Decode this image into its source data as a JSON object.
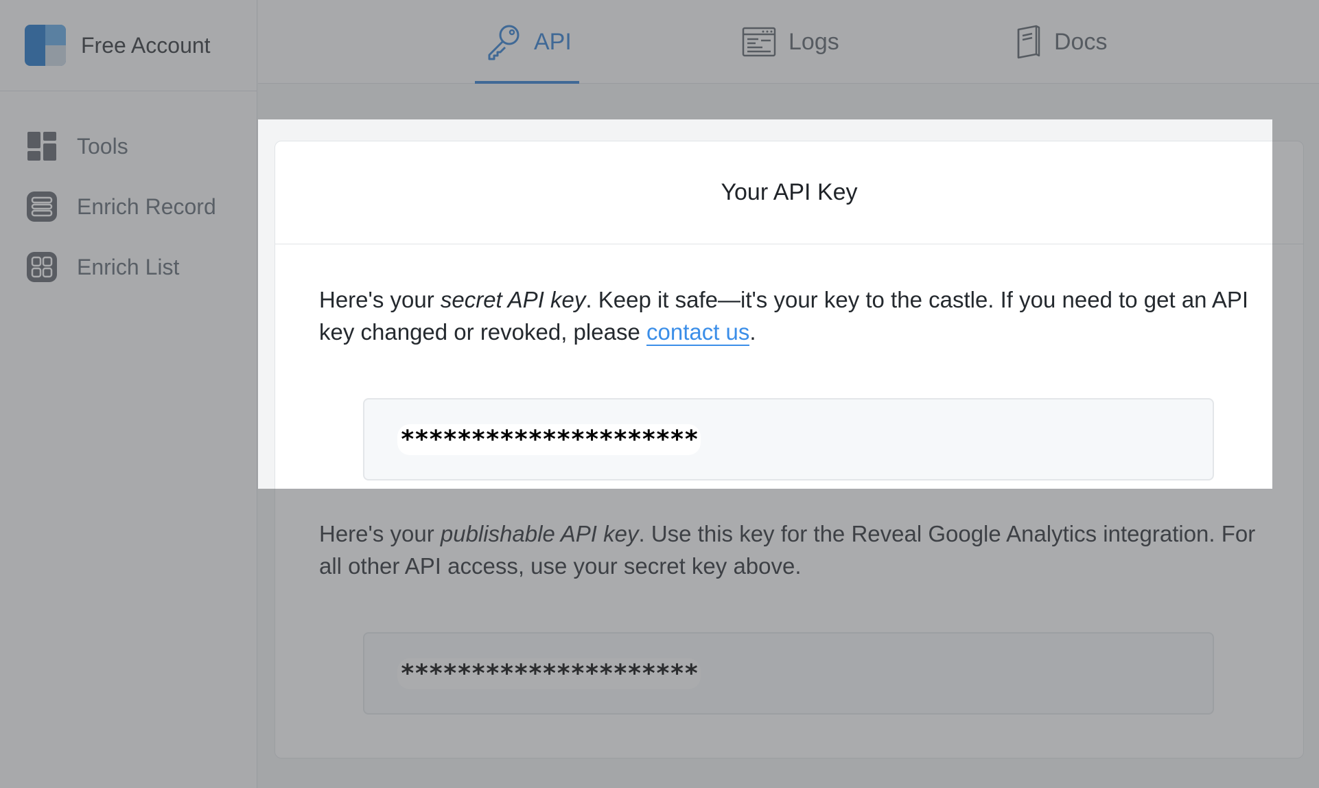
{
  "brand": {
    "name": "Free Account"
  },
  "sidebar": {
    "items": [
      {
        "label": "Tools"
      },
      {
        "label": "Enrich Record"
      },
      {
        "label": "Enrich List"
      }
    ]
  },
  "tabs": [
    {
      "label": "API",
      "active": true
    },
    {
      "label": "Logs",
      "active": false
    },
    {
      "label": "Docs",
      "active": false
    }
  ],
  "card": {
    "title": "Your API Key",
    "secret": {
      "text_before": "Here's your ",
      "emphasis": "secret API key",
      "text_middle": ". Keep it safe—it's your key to the castle. If you need to get an API key changed or revoked, please ",
      "link": "contact us",
      "text_after": ".",
      "masked_key": "*********************"
    },
    "publishable": {
      "text_before": "Here's your ",
      "emphasis": "publishable API key",
      "text_after": ". Use this key for the Reveal Google Analytics integration. For all other API access, use your secret key above.",
      "masked_key": "*********************"
    }
  },
  "colors": {
    "accent": "#2a7bd0",
    "link": "#3b8ee8",
    "overlay": "rgba(85,88,92,0.5)"
  }
}
